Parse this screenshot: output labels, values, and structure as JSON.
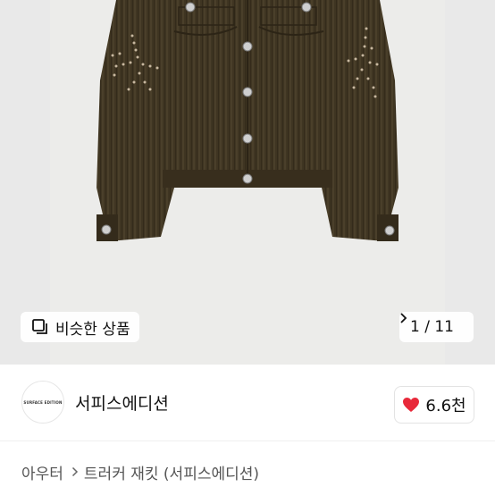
{
  "gallery": {
    "similar_label": "비슷한 상품",
    "counter": "1 / 11",
    "current_image": 1,
    "total_images": 11
  },
  "shop": {
    "name": "서피스에디션",
    "avatar_text": "SURFACE EDITION",
    "like_count": "6.6천"
  },
  "breadcrumb": {
    "category": "아우터",
    "subcategory": "트러커 재킷 (서피스에디션)"
  },
  "colors": {
    "jacket": "#3f3522",
    "heart": "#e8293a"
  }
}
